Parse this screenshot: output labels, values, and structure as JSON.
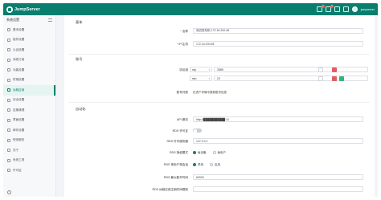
{
  "brand": {
    "name": "JumpServer"
  },
  "topbar": {
    "badges": [
      "2",
      "6"
    ],
    "user_name": "jumpserver"
  },
  "sidebar": {
    "title": "系统设置",
    "items": [
      {
        "label": "基本设置",
        "icon": "gear-icon",
        "active": false
      },
      {
        "label": "组件设置",
        "icon": "component-icon",
        "active": false
      },
      {
        "label": "认证设置",
        "icon": "lock-icon",
        "active": false
      },
      {
        "label": "消息订阅",
        "icon": "message-icon",
        "active": false
      },
      {
        "label": "功能设置",
        "icon": "feature-icon",
        "active": false
      },
      {
        "label": "终端设置",
        "icon": "terminal-icon",
        "active": false
      },
      {
        "label": "远程应用",
        "icon": "app-icon",
        "active": true
      },
      {
        "label": "安全设置",
        "icon": "shield-icon",
        "active": false
      },
      {
        "label": "定期清理",
        "icon": "clean-icon",
        "active": false
      },
      {
        "label": "界面设置",
        "icon": "ui-icon",
        "active": false
      },
      {
        "label": "邮件设置",
        "icon": "mail-icon",
        "active": false
      },
      {
        "label": "短信服务",
        "icon": "sms-icon",
        "active": false
      },
      {
        "label": "关于",
        "icon": "info-icon",
        "active": false
      },
      {
        "label": "系统工具",
        "icon": "tool-icon",
        "active": false
      },
      {
        "label": "许可证",
        "icon": "license-icon",
        "active": false
      }
    ]
  },
  "form": {
    "basic_section": "基本",
    "name_label": "名称",
    "name_value": "测试发布机-172.16.200.48",
    "ip_label": "IP/主机",
    "ip_value": "172.16.200.48",
    "account_section": "账号",
    "protocol_label": "协议组",
    "protocols": [
      {
        "name": "rdp",
        "port": "3389"
      },
      {
        "name": "ssh",
        "port": "22"
      }
    ],
    "account_list_label": "账号列表",
    "account_list_value": "在资产详情中更新账号信息",
    "automation_section": "自动化",
    "api_label": "API 服务",
    "api_value": "http://███████████:10",
    "rds_license_label": "RDS 许可证",
    "rds_server_label": "RDS 许可服务器",
    "rds_server_value": "127.0.0.1",
    "rds_mode_label": "RDS 授权模式",
    "rds_mode_options": [
      "每设备",
      "每用户"
    ],
    "rds_single_label": "RDS 单用户单会话",
    "rds_single_options": [
      "禁用",
      "启用"
    ],
    "rds_idle_label": "RDS 最大断开时间",
    "rds_idle_value": "60000",
    "rds_remote_label": "RDS 远程应用注销时间限制"
  }
}
